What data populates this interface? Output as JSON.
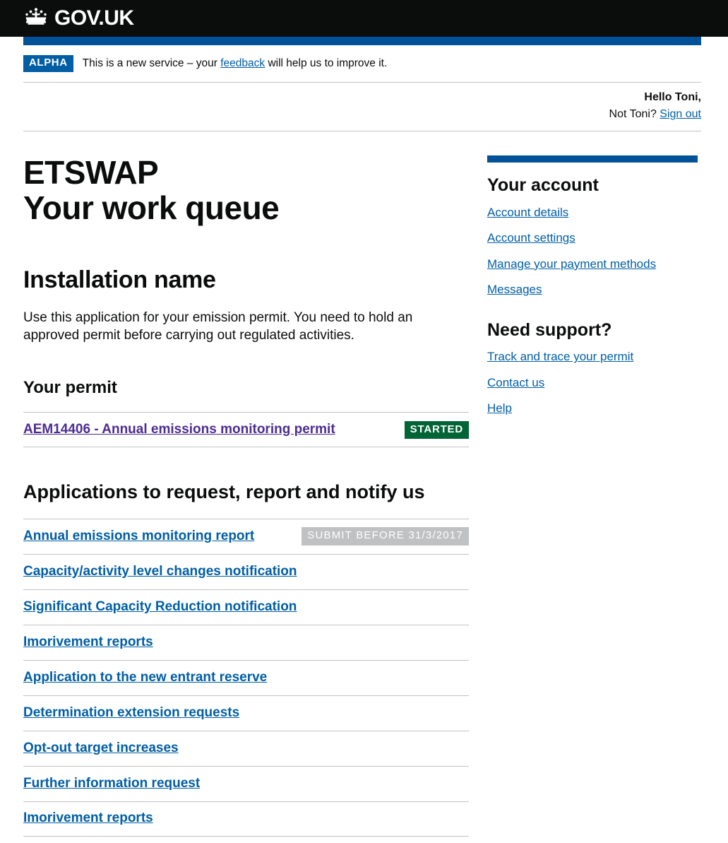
{
  "header": {
    "logo_text": "GOV.UK",
    "crown_icon": "crown-icon"
  },
  "phase_banner": {
    "tag": "ALPHA",
    "text_before": "This is a new service – your ",
    "link": "feedback",
    "text_after": " will help us to improve it."
  },
  "account_strip": {
    "greeting": "Hello Toni,",
    "not_you": "Not Toni? ",
    "sign_out": "Sign out"
  },
  "main": {
    "service_name": "ETSWAP",
    "page_title": "Your work queue",
    "installation_heading": "Installation name",
    "intro": "Use this application for your emission permit. You need to hold an approved permit before carrying out regulated activities.",
    "permit_heading": "Your permit",
    "permit_rows": [
      {
        "label": "AEM14406 - Annual emissions monitoring permit",
        "badge": "STARTED",
        "badge_type": "started",
        "visited": true
      }
    ],
    "applications_heading": "Applications to request, report and notify us",
    "application_rows": [
      {
        "label": "Annual emissions monitoring report",
        "badge": "SUBMIT BEFORE 31/3/2017",
        "badge_type": "due"
      },
      {
        "label": "Capacity/activity level changes notification",
        "badge": "",
        "badge_type": ""
      },
      {
        "label": "Significant Capacity Reduction notification",
        "badge": "",
        "badge_type": ""
      },
      {
        "label": "Imorivement reports",
        "badge": "",
        "badge_type": ""
      },
      {
        "label": "Application to the new entrant reserve",
        "badge": "",
        "badge_type": ""
      },
      {
        "label": "Determination extension requests",
        "badge": "",
        "badge_type": ""
      },
      {
        "label": "Opt-out target increases",
        "badge": "",
        "badge_type": ""
      },
      {
        "label": "Further information request",
        "badge": "",
        "badge_type": ""
      },
      {
        "label": "Imorivement reports",
        "badge": "",
        "badge_type": ""
      }
    ]
  },
  "sidebar": {
    "account_heading": "Your account",
    "account_links": [
      "Account details",
      "Account settings",
      "Manage your payment methods",
      "Messages"
    ],
    "support_heading": "Need support?",
    "support_links": [
      "Track and trace your permit",
      "Contact us",
      "Help"
    ]
  },
  "colors": {
    "header_black": "#0b0c0c",
    "govuk_blue": "#005198",
    "link_blue": "#005ea5",
    "visited_purple": "#4c2c92",
    "green_badge": "#006435",
    "grey_badge": "#bfc1c3"
  }
}
